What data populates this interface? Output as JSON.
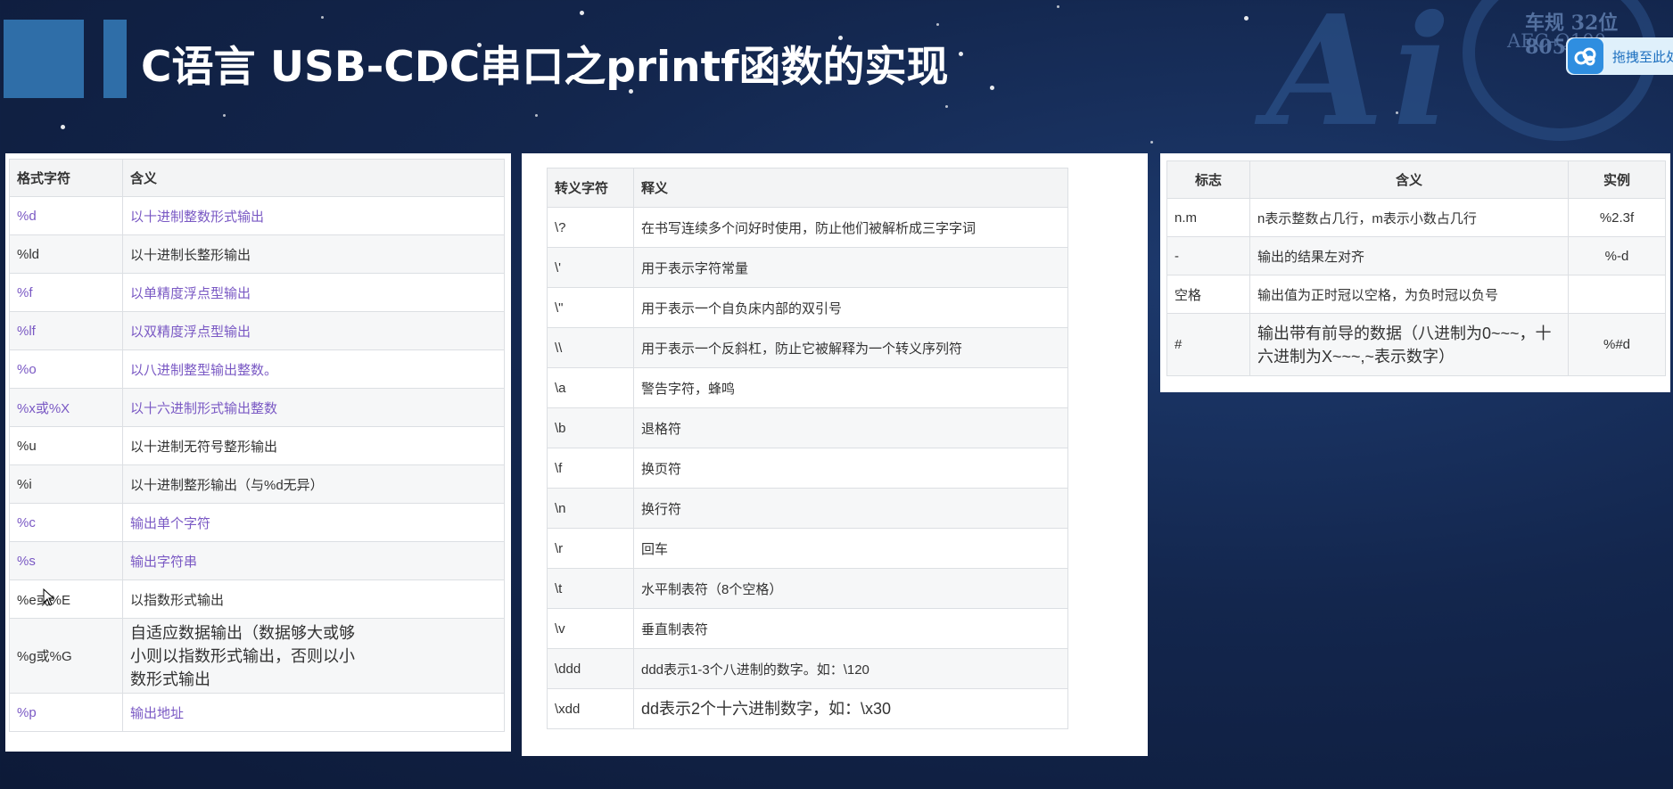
{
  "title": "C语言 USB-CDC串口之printf函数的实现",
  "logo": {
    "text1": "车规 32位 8051",
    "text2": "AEC-Q100",
    "brand": "Ai"
  },
  "badge": {
    "label": "拖拽至此处"
  },
  "format_table": {
    "headers": [
      "格式字符",
      "含义"
    ],
    "rows": [
      {
        "spec": "%d",
        "meaning": "以十进制整数形式输出",
        "highlight": true
      },
      {
        "spec": "%ld",
        "meaning": "以十进制长整形输出",
        "highlight": false
      },
      {
        "spec": "%f",
        "meaning": "以单精度浮点型输出",
        "highlight": true
      },
      {
        "spec": "%lf",
        "meaning": "以双精度浮点型输出",
        "highlight": true
      },
      {
        "spec": "%o",
        "meaning": "以八进制整型输出整数。",
        "highlight": true
      },
      {
        "spec": "%x或%X",
        "meaning": "以十六进制形式输出整数",
        "highlight": true
      },
      {
        "spec": "%u",
        "meaning": "以十进制无符号整形输出",
        "highlight": false
      },
      {
        "spec": "%i",
        "meaning": "以十进制整形输出（与%d无异）",
        "highlight": false
      },
      {
        "spec": "%c",
        "meaning": "输出单个字符",
        "highlight": true
      },
      {
        "spec": "%s",
        "meaning": "输出字符串",
        "highlight": true
      },
      {
        "spec": "%e或%E",
        "meaning": "以指数形式输出",
        "highlight": false
      },
      {
        "spec": "%g或%G",
        "meaning": "自适应数据输出（数据够大或够小则以指数形式输出，否则以小数形式输出",
        "highlight": false
      },
      {
        "spec": "%p",
        "meaning": "输出地址",
        "highlight": true
      }
    ]
  },
  "escape_table": {
    "headers": [
      "转义字符",
      "释义"
    ],
    "rows": [
      {
        "char": "\\?",
        "meaning": "在书写连续多个问好时使用，防止他们被解析成三字字词"
      },
      {
        "char": "\\'",
        "meaning": "用于表示字符常量"
      },
      {
        "char": "\\\"",
        "meaning": "用于表示一个自负床内部的双引号"
      },
      {
        "char": "\\\\",
        "meaning": "用于表示一个反斜杠，防止它被解释为一个转义序列符"
      },
      {
        "char": "\\a",
        "meaning": "警告字符，蜂鸣"
      },
      {
        "char": "\\b",
        "meaning": "退格符"
      },
      {
        "char": "\\f",
        "meaning": "换页符"
      },
      {
        "char": "\\n",
        "meaning": "换行符"
      },
      {
        "char": "\\r",
        "meaning": "回车"
      },
      {
        "char": "\\t",
        "meaning": "水平制表符（8个空格）"
      },
      {
        "char": "\\v",
        "meaning": "垂直制表符"
      },
      {
        "char": "\\ddd",
        "meaning": "ddd表示1-3个八进制的数字。如：\\120"
      },
      {
        "char": "\\xdd",
        "meaning": "dd表示2个十六进制数字，如：\\x30"
      }
    ]
  },
  "flags_table": {
    "headers": [
      "标志",
      "含义",
      "实例"
    ],
    "rows": [
      {
        "flag": "n.m",
        "meaning": "n表示整数占几行，m表示小数占几行",
        "example": "%2.3f"
      },
      {
        "flag": "-",
        "meaning": "输出的结果左对齐",
        "example": "%-d"
      },
      {
        "flag": "空格",
        "meaning": "输出值为正时冠以空格，为负时冠以负号",
        "example": ""
      },
      {
        "flag": "#",
        "meaning": "输出带有前导的数据（八进制为0~~~，十六进制为X~~~,~表示数字）",
        "example": "%#d"
      }
    ]
  }
}
